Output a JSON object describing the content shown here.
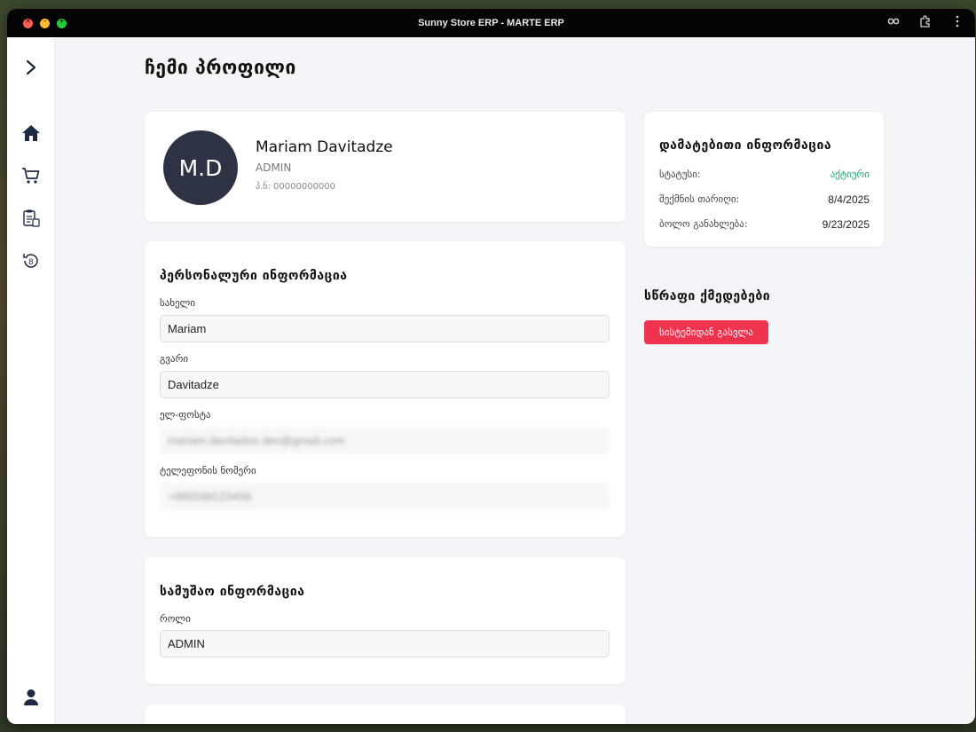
{
  "window": {
    "title": "Sunny Store ERP - MARTE ERP"
  },
  "page": {
    "title": "ჩემი პროფილი"
  },
  "profile": {
    "initials": "M.D",
    "name": "Mariam Davitadze",
    "role": "ADMIN",
    "id_line": "პ.ნ: 00000000000"
  },
  "personal": {
    "title": "პერსონალური ინფორმაცია",
    "first_name_label": "სახელი",
    "first_name": "Mariam",
    "last_name_label": "გვარი",
    "last_name": "Davitadze",
    "email_label": "ელ-ფოსტა",
    "email": "mariam.davitadze.dev@gmail.com",
    "phone_label": "ტელეფონის ნომერი",
    "phone": "+995599123456"
  },
  "work": {
    "title": "სამუშაო ინფორმაცია",
    "role_label": "როლი",
    "role": "ADMIN"
  },
  "additional": {
    "title": "დამატებითი ინფორმაცია",
    "status_label": "სტატუსი:",
    "status": "აქტიური",
    "created_label": "შექმნის თარიღი:",
    "created": "8/4/2025",
    "updated_label": "ბოლო განახლება:",
    "updated": "9/23/2025"
  },
  "quick": {
    "title": "სწრაფი ქმედებები",
    "logout": "სისტემიდან გასვლა"
  },
  "colors": {
    "accent": "#1e2a44",
    "danger": "#f0334f",
    "success": "#22a06b"
  }
}
